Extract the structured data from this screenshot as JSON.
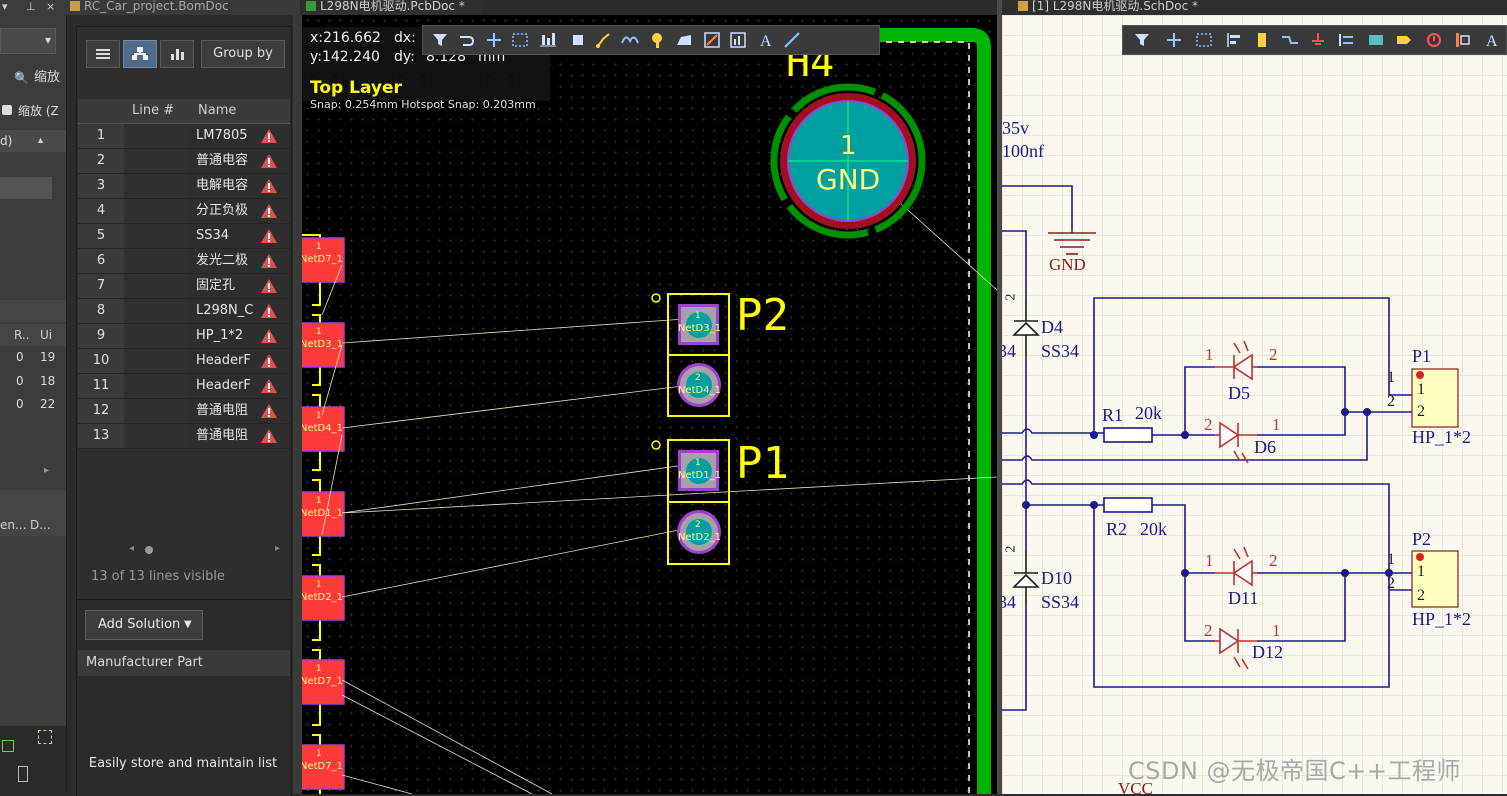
{
  "left_strip": {
    "tab_close": "×",
    "zoom_label_1": "缩放",
    "zoom_label_2": "缩放 (Z",
    "combo_partial": "d)",
    "col_r": "R..",
    "col_u": "Ui",
    "rows": [
      {
        "a": "0",
        "b": "19"
      },
      {
        "a": "0",
        "b": "18"
      },
      {
        "a": "0",
        "b": "22"
      }
    ],
    "col_en": "en...",
    "col_d": "D..."
  },
  "bom": {
    "tab_title": "RC_Car_project.BomDoc",
    "group_by_label": "Group by",
    "columns": {
      "line": "Line #",
      "name": "Name"
    },
    "rows": [
      {
        "num": "1",
        "name": "LM7805"
      },
      {
        "num": "2",
        "name": "普通电容"
      },
      {
        "num": "3",
        "name": "电解电容"
      },
      {
        "num": "4",
        "name": "分正负极"
      },
      {
        "num": "5",
        "name": "SS34"
      },
      {
        "num": "6",
        "name": "发光二极"
      },
      {
        "num": "7",
        "name": "固定孔"
      },
      {
        "num": "8",
        "name": "L298N_C"
      },
      {
        "num": "9",
        "name": "HP_1*2"
      },
      {
        "num": "10",
        "name": "HeaderF"
      },
      {
        "num": "11",
        "name": "HeaderF"
      },
      {
        "num": "12",
        "name": "普通电阻"
      },
      {
        "num": "13",
        "name": "普通电阻"
      }
    ],
    "visible_lines": "13 of 13 lines visible",
    "add_solution_label": "Add Solution",
    "manufacturer_part_label": "Manufacturer Part",
    "easily_store_text": "Easily store and maintain list"
  },
  "pcb": {
    "tab_title": "L298N电机驱动.PcbDoc *",
    "x_readout": "x:216.662",
    "y_readout": "y:142.240",
    "dx_label": "dx:",
    "dy_label": "dy:",
    "dy_value": "8.128",
    "unit": "mm",
    "layer": "Top Layer",
    "snap": "Snap: 0.254mm Hotspot Snap: 0.203mm",
    "h4_label": "H4",
    "h4_pad_num": "1",
    "h4_net": "GND",
    "p2_label": "P2",
    "p1_label": "P1",
    "pad_num_1": "1",
    "pad_num_2": "2",
    "p2_pad1_net": "NetD3_1",
    "p2_pad2_net": "NetD4_1",
    "p1_pad1_net": "NetD1_1",
    "p1_pad2_net": "NetD2_1",
    "left_pad_nets": [
      "NetD7_1",
      "NetD3_1",
      "NetD4_1",
      "NetD1_1",
      "NetD2_1",
      "NetD7_1",
      "NetD7_1"
    ],
    "left_pad_num": "1",
    "colors": {
      "pad": "#ff3a3a",
      "silkscreen": "#ffff00",
      "board_edge": "#00c000"
    }
  },
  "sch": {
    "tab_title": "[1] L298N电机驱动.SchDoc *",
    "cap_v": "35v",
    "cap_val": "100nf",
    "gnd": "GND",
    "d4": "D4",
    "d4_part": "SS34",
    "d10": "D10",
    "d10_part": "SS34",
    "partial_34": "34",
    "pin_2": "2",
    "pin_1": "1",
    "r1": "R1",
    "r1_val": "20k",
    "r2": "R2",
    "r2_val": "20k",
    "d5": "D5",
    "d6": "D6",
    "d11": "D11",
    "d12": "D12",
    "p1": "P1",
    "p1_part": "HP_1*2",
    "p2": "P2",
    "p2_part": "HP_1*2",
    "vcc": "VCC",
    "watermark": "CSDN @无极帝国C++工程师"
  }
}
